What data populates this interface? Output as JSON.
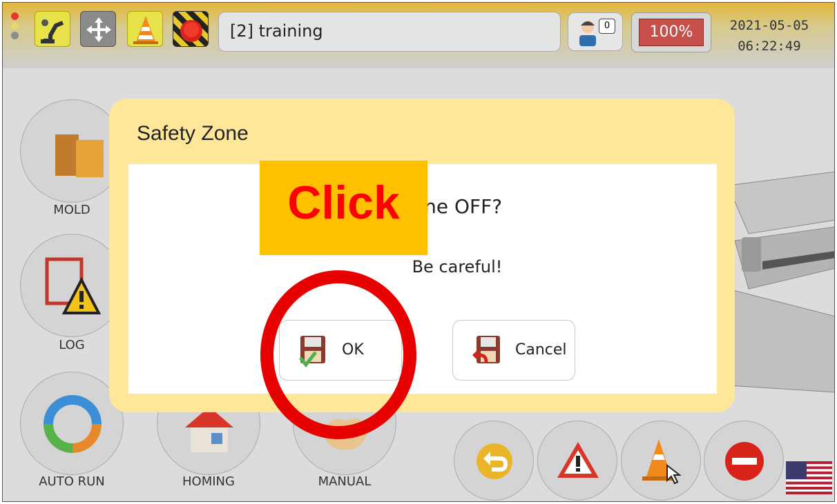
{
  "topbar": {
    "title": "[2] training",
    "user_count": "0",
    "speed": "100%",
    "date": "2021-05-05",
    "time": "06:22:49"
  },
  "side_menu": [
    {
      "label": "MOLD",
      "icon": "mold-icon"
    },
    {
      "label": "LOG",
      "icon": "log-warning-icon"
    }
  ],
  "bottom_menu": [
    {
      "label": "AUTO RUN",
      "icon": "cycle-icon"
    },
    {
      "label": "HOMING",
      "icon": "home-icon"
    },
    {
      "label": "MANUAL",
      "icon": "hand-icon"
    }
  ],
  "bottom_buttons": [
    "return-icon",
    "warning-icon",
    "safety-cone-icon",
    "stop-icon"
  ],
  "dialog": {
    "title": "Safety Zone",
    "message": "one OFF?",
    "warning": "Be careful!",
    "ok_label": "OK",
    "cancel_label": "Cancel"
  },
  "annotation": {
    "text": "Click",
    "box_color": "#ffc000",
    "text_color": "#ff0000",
    "ring_color": "#e60000"
  },
  "colors": {
    "dialog_bg": "#ffe79a",
    "speed_bg": "#c8504a",
    "topbar_accent": "#e3b73a"
  },
  "language": "English (US flag)"
}
